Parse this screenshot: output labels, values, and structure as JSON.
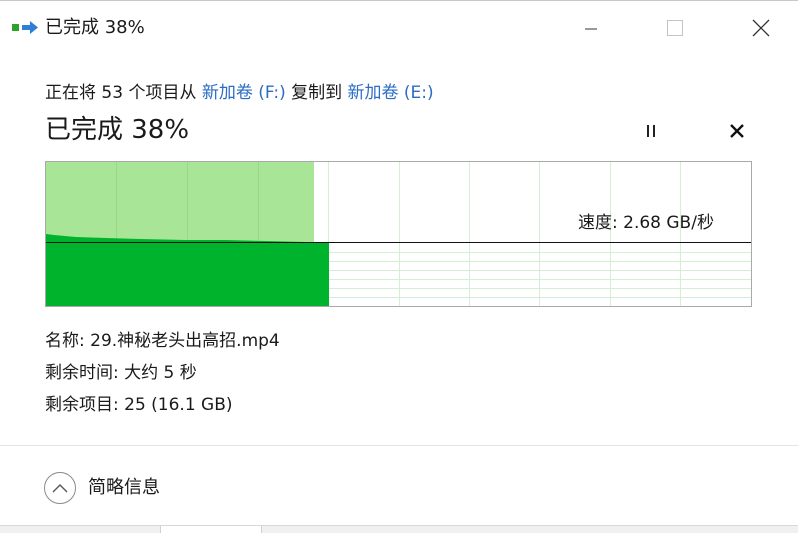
{
  "window": {
    "title": "已完成 38%",
    "icon": "file-copy-icon"
  },
  "operation": {
    "prefix": "正在将 53 个项目从 ",
    "source": "新加卷 (F:)",
    "middle": " 复制到 ",
    "destination": "新加卷 (E:)",
    "link_color": "#2b6cc4"
  },
  "progress": {
    "heading": "已完成 38%",
    "percent": 38
  },
  "controls": {
    "pause_icon": "pause-icon",
    "cancel_icon": "close-icon"
  },
  "graph": {
    "speed_label": "速度: 2.68 GB/秒",
    "fill_color": "#00b32c",
    "done_color": "#a9e596"
  },
  "details": {
    "name_line": "名称: 29.神秘老头出高招.mp4",
    "time_line": "剩余时间: 大约 5 秒",
    "items_line": "剩余项目: 25 (16.1 GB)"
  },
  "footer": {
    "less_details_label": "简略信息",
    "icon": "chevron-up-icon"
  }
}
